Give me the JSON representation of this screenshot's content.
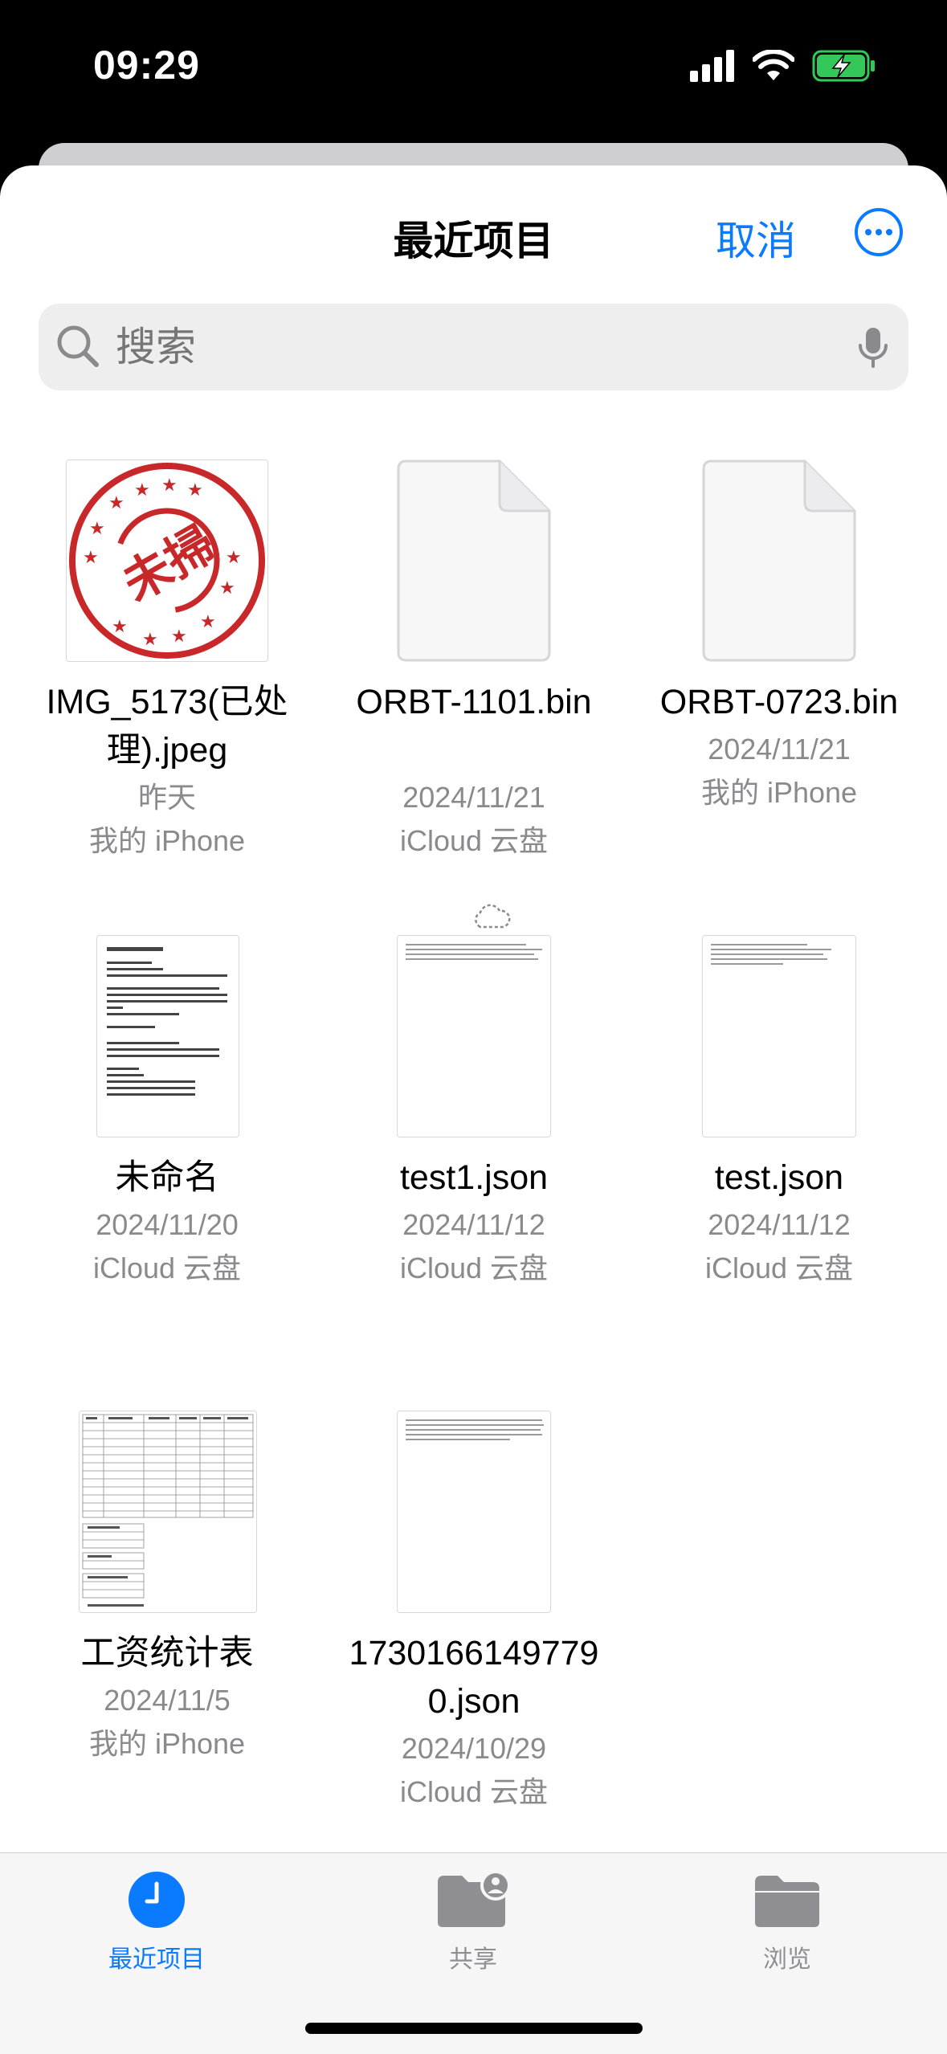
{
  "status": {
    "time": "09:29"
  },
  "header": {
    "title": "最近项目",
    "cancel_label": "取消"
  },
  "search": {
    "placeholder": "搜索"
  },
  "files": [
    {
      "name": "IMG_5173(已处理).jpeg",
      "date": "昨天",
      "location": "我的 iPhone",
      "stamp_text": "未掃"
    },
    {
      "name": "ORBT-1101.bin",
      "date": "2024/11/21",
      "location": "iCloud 云盘"
    },
    {
      "name": "ORBT-0723.bin",
      "date": "2024/11/21",
      "location": "我的 iPhone"
    },
    {
      "name": "未命名",
      "date": "2024/11/20",
      "location": "iCloud 云盘"
    },
    {
      "name": "test1.json",
      "date": "2024/11/12",
      "location": "iCloud 云盘"
    },
    {
      "name": "test.json",
      "date": "2024/11/12",
      "location": "iCloud 云盘"
    },
    {
      "name": "工资统计表",
      "date": "2024/11/5",
      "location": "我的 iPhone"
    },
    {
      "name": "17301661497790.json",
      "date": "2024/10/29",
      "location": "iCloud 云盘"
    }
  ],
  "tabs": [
    {
      "label": "最近项目",
      "active": true
    },
    {
      "label": "共享",
      "active": false
    },
    {
      "label": "浏览",
      "active": false
    }
  ],
  "colors": {
    "accent": "#0a7aff",
    "secondary_text": "#8a8a8e",
    "stamp_red": "#c8282a",
    "battery_green": "#34c759"
  }
}
